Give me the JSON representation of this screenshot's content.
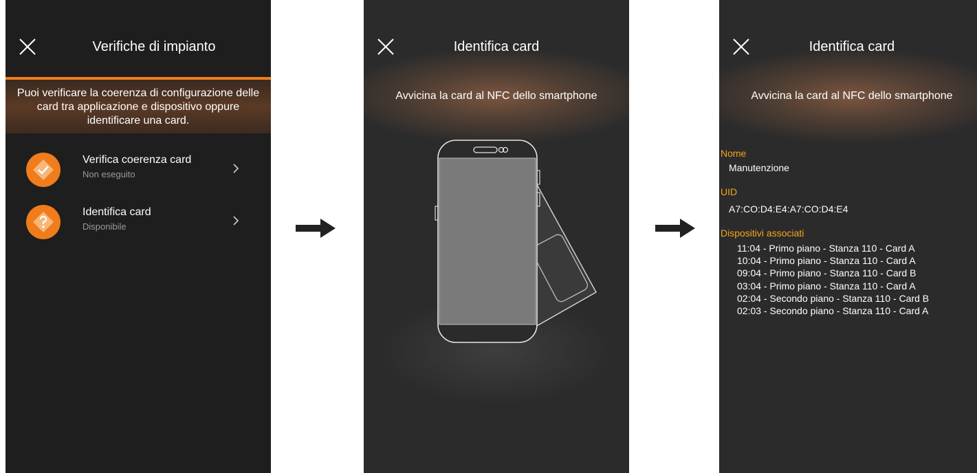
{
  "screen1": {
    "title": "Verifiche di impianto",
    "banner_text": "Puoi verificare la coerenza di configurazione delle card tra applicazione e dispositivo oppure identificare una card.",
    "items": [
      {
        "label": "Verifica coerenza card",
        "status": "Non eseguito",
        "icon": "check-diamond-icon"
      },
      {
        "label": "Identifica card",
        "status": "Disponibile",
        "icon": "question-diamond-icon"
      }
    ]
  },
  "screen2": {
    "title": "Identifica card",
    "subtitle": "Avvicina la card al NFC dello smartphone"
  },
  "screen3": {
    "title": "Identifica card",
    "subtitle": "Avvicina la card al NFC dello smartphone",
    "name_label": "Nome",
    "name_value": "Manutenzione",
    "uid_label": "UID",
    "uid_value": "A7:CO:D4:E4:A7:CO:D4:E4",
    "devices_label": "Dispositivi associati",
    "devices": [
      "11:04 - Primo piano - Stanza 110 - Card A",
      "10:04 - Primo piano - Stanza 110 - Card A",
      "09:04 - Primo piano - Stanza 110 - Card B",
      "03:04 - Primo piano - Stanza 110 - Card A",
      "02:04 - Secondo piano - Stanza 110 - Card B",
      "02:03 - Secondo piano - Stanza 110 - Card A"
    ]
  },
  "colors": {
    "accent": "#f07c1c",
    "label_yellow": "#f7a51c",
    "screen_bg": "#2b2b2b"
  }
}
